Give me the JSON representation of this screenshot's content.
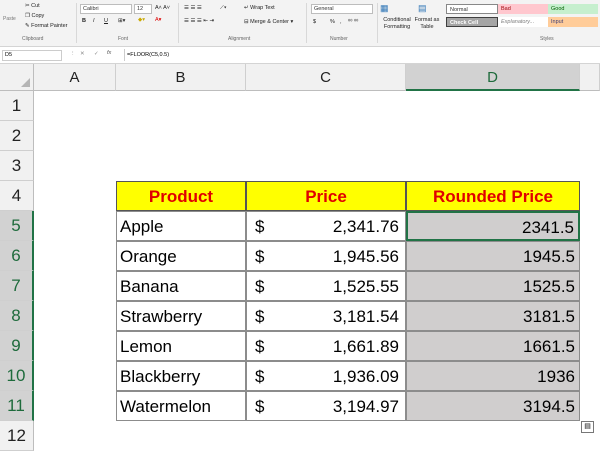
{
  "ribbon": {
    "clipboard": {
      "paste": "Paste",
      "cut": "Cut",
      "copy": "Copy",
      "format_painter": "Format Painter",
      "label": "Clipboard"
    },
    "font": {
      "name": "Calibri",
      "size": "12",
      "bold": "B",
      "italic": "I",
      "underline": "U",
      "label": "Font"
    },
    "alignment": {
      "wrap_text": "Wrap Text",
      "merge_center": "Merge & Center",
      "label": "Alignment"
    },
    "number": {
      "format": "General",
      "currency": "$",
      "percent": "%",
      "comma": ",",
      "label": "Number"
    },
    "conditional_formatting": "Conditional Formatting",
    "format_as_table": "Format as Table",
    "styles": {
      "normal": "Normal",
      "bad": "Bad",
      "good": "Good",
      "check_cell": "Check Cell",
      "explanatory": "Explanatory...",
      "input": "Input",
      "label": "Styles"
    }
  },
  "formula_bar": {
    "name_box": "D5",
    "cancel": "✕",
    "enter": "✓",
    "fx": "fx",
    "formula": "=FLOOR(C5,0.5)"
  },
  "columns": [
    "A",
    "B",
    "C",
    "D"
  ],
  "rows": [
    "1",
    "2",
    "3",
    "4",
    "5",
    "6",
    "7",
    "8",
    "9",
    "10",
    "11",
    "12"
  ],
  "table": {
    "headers": [
      "Product",
      "Price",
      "Rounded Price"
    ],
    "rows": [
      {
        "product": "Apple",
        "currency": "$",
        "price": "2,341.76",
        "rounded": "2341.5"
      },
      {
        "product": "Orange",
        "currency": "$",
        "price": "1,945.56",
        "rounded": "1945.5"
      },
      {
        "product": "Banana",
        "currency": "$",
        "price": "1,525.55",
        "rounded": "1525.5"
      },
      {
        "product": "Strawberry",
        "currency": "$",
        "price": "3,181.54",
        "rounded": "3181.5"
      },
      {
        "product": "Lemon",
        "currency": "$",
        "price": "1,661.89",
        "rounded": "1661.5"
      },
      {
        "product": "Blackberry",
        "currency": "$",
        "price": "1,936.09",
        "rounded": "1936"
      },
      {
        "product": "Watermelon",
        "currency": "$",
        "price": "3,194.97",
        "rounded": "3194.5"
      }
    ]
  },
  "colors": {
    "header_fill": "#ffff00",
    "header_text": "#e00000",
    "selection_fill": "#d0cece",
    "excel_green": "#217346"
  }
}
